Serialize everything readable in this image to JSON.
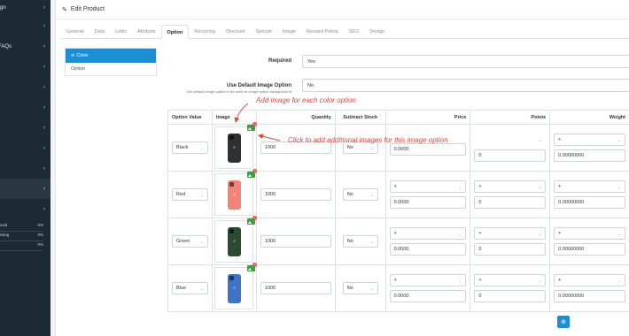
{
  "sidebar": {
    "items": [
      {
        "label": "Design"
      },
      {
        "label": ""
      },
      {
        "label": "ate FAQs"
      },
      {
        "label": ""
      },
      {
        "label": "ns"
      },
      {
        "label": ""
      },
      {
        "label": ""
      },
      {
        "label": "rs"
      },
      {
        "label": "g"
      },
      {
        "label": ""
      },
      {
        "label": ""
      }
    ],
    "progress": [
      {
        "label": "sold",
        "value": "0%",
        "fill": 0
      },
      {
        "label": "ssing",
        "value": "0%",
        "fill": 0
      },
      {
        "label": "",
        "value": "0%",
        "fill": 0
      }
    ]
  },
  "page": {
    "title": "Edit Product"
  },
  "tabs": [
    "General",
    "Data",
    "Links",
    "Attribute",
    "Option",
    "Recurring",
    "Discount",
    "Special",
    "Image",
    "Reward Points",
    "SEO",
    "Design"
  ],
  "active_tab": "Option",
  "options_list": {
    "active": "Color",
    "other": "Option"
  },
  "required": {
    "label": "Required",
    "value": "Yes"
  },
  "default_image": {
    "label": "Use Default Image Option",
    "help": "Use default image option to be used as image option background",
    "value": "No"
  },
  "table": {
    "headers": [
      "Option Value",
      "Image",
      "Quantity",
      "Subtract Stock",
      "Price",
      "Points",
      "Weight"
    ],
    "rows": [
      {
        "value": "Black",
        "color": "#2e3133",
        "quantity": "1000",
        "subtract": "No",
        "price_prefix": "",
        "price": "0.0000",
        "points_prefix": "",
        "points": "0",
        "weight_prefix": "+",
        "weight": "0.00000000"
      },
      {
        "value": "Red",
        "color": "#f08577",
        "quantity": "1000",
        "subtract": "No",
        "price_prefix": "+",
        "price": "0.0000",
        "points_prefix": "+",
        "points": "0",
        "weight_prefix": "+",
        "weight": "0.00000000"
      },
      {
        "value": "Green",
        "color": "#2c4a33",
        "quantity": "1000",
        "subtract": "No",
        "price_prefix": "+",
        "price": "0.0000",
        "points_prefix": "+",
        "points": "0",
        "weight_prefix": "+",
        "weight": "0.00000000"
      },
      {
        "value": "Blue",
        "color": "#3f72c9",
        "quantity": "1000",
        "subtract": "No",
        "price_prefix": "+",
        "price": "0.0000",
        "points_prefix": "+",
        "points": "0",
        "weight_prefix": "+",
        "weight": "0.00000000"
      }
    ]
  },
  "annotations": {
    "color_option": "Add image for each color option",
    "additional_images": "Click to add additional images for this image option"
  },
  "colors": {
    "accent": "#1c8ed6",
    "annotation": "#e2463b",
    "sidebar": "#1e2a33",
    "add_image": "#3aa03f"
  },
  "icons": [
    "pencil-icon",
    "add-image-icon",
    "plus-circle-icon",
    "chevron-right-icon",
    "chevron-down-icon"
  ]
}
